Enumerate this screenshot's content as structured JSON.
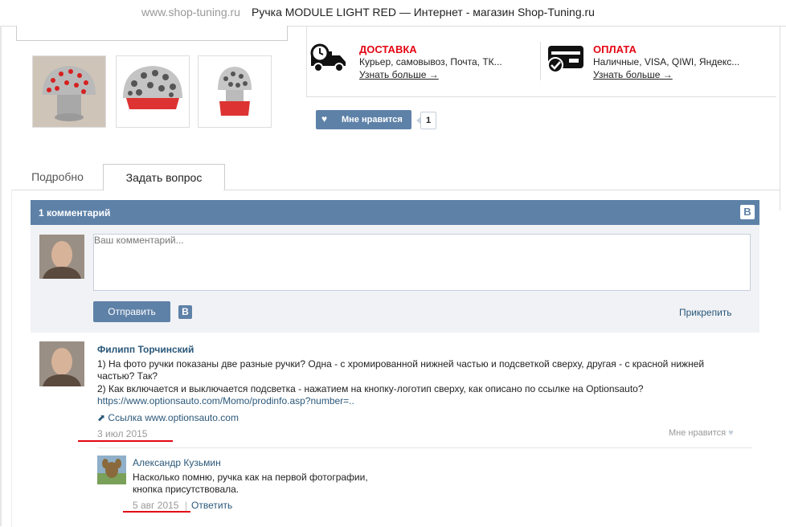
{
  "titlebar": {
    "site": "www.shop-tuning.ru",
    "title": "Ручка MODULE LIGHT RED — Интернет - магазин Shop-Tuning.ru"
  },
  "delivery": {
    "icon": "truck-icon",
    "title": "ДОСТАВКА",
    "text": "Курьер, самовывоз, Почта, ТК...",
    "link": "Узнать больше →"
  },
  "payment": {
    "icon": "payment-card-icon",
    "title": "ОПЛАТА",
    "text": "Наличные, VISA, QIWI, Яндекс...",
    "link": "Узнать больше →"
  },
  "like": {
    "label": "Мне нравится",
    "count": "1"
  },
  "tabs": [
    {
      "label": "Подробно"
    },
    {
      "label": "Задать вопрос"
    }
  ],
  "vk": {
    "header": "1 комментарий",
    "logo": "B",
    "placeholder": "Ваш комментарий...",
    "send": "Отправить",
    "attach": "Прикрепить"
  },
  "comment": {
    "author": "Филипп Торчинский",
    "line1": "1) На фото ручки показаны две разные ручки? Одна - с хромированной нижней частью и подсветкой сверху, другая - с красной нижней",
    "line2": "частью? Так?",
    "line3": "2) Как включается и выключается подсветка - нажатием на кнопку-логотип сверху, как описано по ссылке на Optionsauto?",
    "url": "https://www.optionsauto.com/Momo/prodinfo.asp?number=..",
    "link_label": "Ссылка www.optionsauto.com",
    "date": "3 июл 2015",
    "like": "Мне нравится"
  },
  "reply": {
    "author": "Александр Кузьмин",
    "line1": "Насколько помню, ручка как на первой фотографии,",
    "line2": "кнопка присутствовала.",
    "date": "5 авг 2015",
    "sep": "|",
    "reply": "Ответить"
  }
}
